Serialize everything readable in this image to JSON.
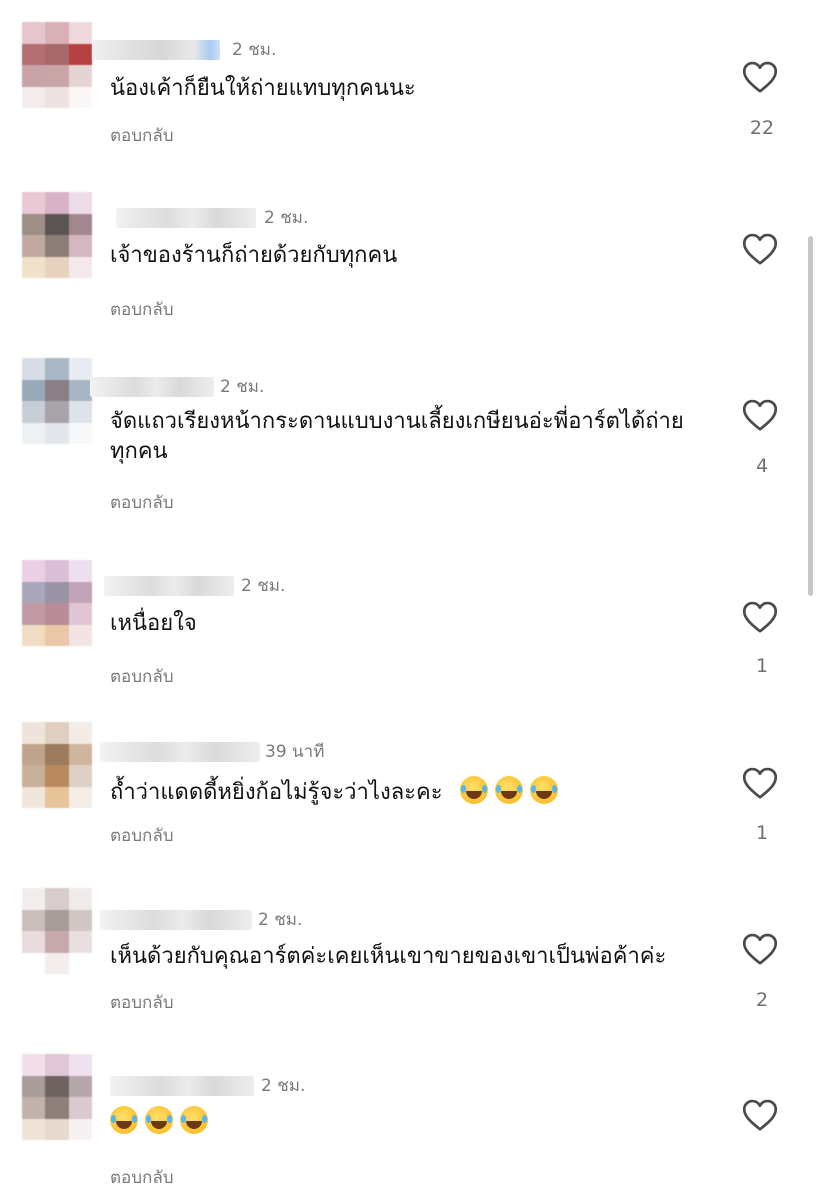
{
  "comments": [
    {
      "time": "2 ชม.",
      "text": "น้องเค้าก็ยืนให้ถ่ายแทบทุกคนนะ",
      "reply_label": "ตอบกลับ",
      "likes": "22",
      "emojis": 0
    },
    {
      "time": "2 ชม.",
      "text": "เจ้าของร้านก็ถ่ายด้วยกับทุกคน",
      "reply_label": "ตอบกลับ",
      "likes": "",
      "emojis": 0
    },
    {
      "time": "2 ชม.",
      "text": "จัดแถวเรียงหน้ากระดานแบบงานเลี้ยงเกษียนอ่ะพี่อาร์ตได้ถ่ายทุกคน",
      "reply_label": "ตอบกลับ",
      "likes": "4",
      "emojis": 0
    },
    {
      "time": "2 ชม.",
      "text": "เหนื่อยใจ",
      "reply_label": "ตอบกลับ",
      "likes": "1",
      "emojis": 0
    },
    {
      "time": "39 นาที",
      "text": "ถ้ำว่าแดดดี้หยิ่งก้อไม่รู้จะว่าไงละคะ",
      "reply_label": "ตอบกลับ",
      "likes": "1",
      "emojis": 3
    },
    {
      "time": "2 ชม.",
      "text": "เห็นด้วยกับคุณอาร์ตค่ะเคยเห็นเขาขายของเขาเป็นพ่อค้าค่ะ",
      "reply_label": "ตอบกลับ",
      "likes": "2",
      "emojis": 0
    },
    {
      "time": "2 ชม.",
      "text": "",
      "reply_label": "ตอบกลับ",
      "likes": "",
      "emojis": 3
    }
  ],
  "icons": {
    "like": "heart-outline-icon",
    "emoji": "face-with-tears-of-joy-icon"
  },
  "colors": {
    "text": "#111111",
    "secondary": "#7a7a7a",
    "heart_stroke": "#4a4a4a"
  }
}
